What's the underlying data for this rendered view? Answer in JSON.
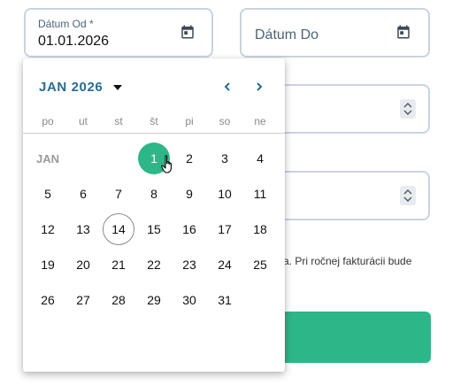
{
  "date_from": {
    "label": "Dátum Od *",
    "value": "01.01.2026",
    "icon": "calendar-icon"
  },
  "date_to": {
    "placeholder": "Dátum Do",
    "icon": "calendar-icon"
  },
  "helper_text": "ca. Pri ročnej fakturácii bude",
  "accent_color": "#2db688",
  "calendar": {
    "month_year": "JAN 2026",
    "prev_icon": "chevron-left-icon",
    "next_icon": "chevron-right-icon",
    "weekdays": [
      "po",
      "ut",
      "st",
      "št",
      "pi",
      "so",
      "ne"
    ],
    "month_short": "JAN",
    "selected_day": "1",
    "today_day": "14",
    "weeks": [
      [
        "JAN",
        "",
        "",
        "1",
        "2",
        "3",
        "4"
      ],
      [
        "5",
        "6",
        "7",
        "8",
        "9",
        "10",
        "11"
      ],
      [
        "12",
        "13",
        "14",
        "15",
        "16",
        "17",
        "18"
      ],
      [
        "19",
        "20",
        "21",
        "22",
        "23",
        "24",
        "25"
      ],
      [
        "26",
        "27",
        "28",
        "29",
        "30",
        "31",
        ""
      ]
    ]
  }
}
